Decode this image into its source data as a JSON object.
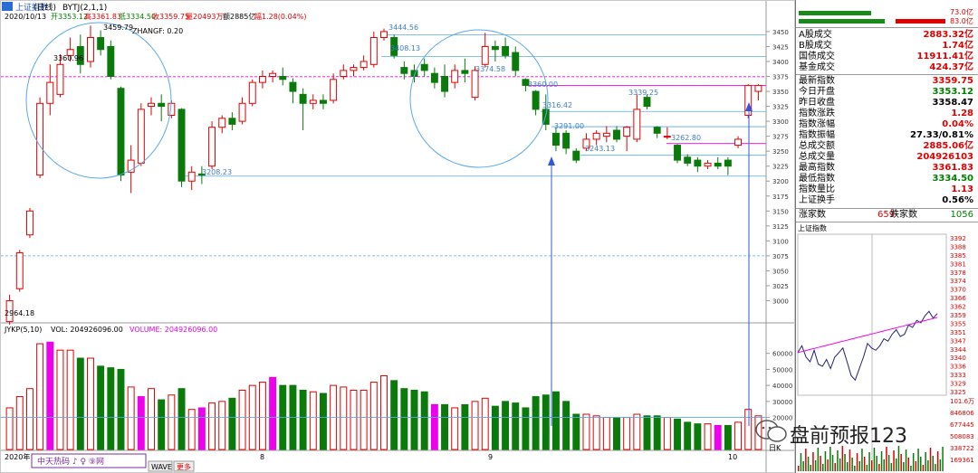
{
  "header": {
    "index_name": "上证指数",
    "period": "(日线)",
    "indicator": "BYTJ(2,1,1)",
    "date": "2020/10/13",
    "open": "开3353.12",
    "high": "高3361.83",
    "low": "低3334.50",
    "close": "收3359.75",
    "volume": "量20493万",
    "amount": "额2885亿",
    "change": "幅1.28(0.04%)",
    "zhangf": "ZHANGF: 0.20"
  },
  "annotations": {
    "a1": "3459.79",
    "a2": "3360.96",
    "a3": "3444.56",
    "a4": "3408.13",
    "a5": "3374.58",
    "a6": "3360.00",
    "a7": "3316.42",
    "a8": "3291.00",
    "a9": "3243.13",
    "a10": "3262.80",
    "a11": "3339.25",
    "a12": "3208.23",
    "a13": "2964.18"
  },
  "volume_header": {
    "name": "JYKP(5,10)",
    "vol": "VOL: 204926096.00",
    "volume": "VOLUME: 204926096.00"
  },
  "bottom_bar": {
    "year": "2020年",
    "m8": "8",
    "m9": "9",
    "m10": "10",
    "site": "中天热码 ♪ ♀ ⑨网",
    "tab_wave": "WAVE",
    "tab_more": "更多",
    "dayk": "日K"
  },
  "right_panel": {
    "top_vals": [
      "73.0亿",
      "83.0亿"
    ],
    "rows1": [
      {
        "label": "A股成交",
        "value": "2883.32亿",
        "color": "#e00000"
      },
      {
        "label": "B股成交",
        "value": "1.74亿",
        "color": "#e00000"
      },
      {
        "label": "国债成交",
        "value": "11911.41亿",
        "color": "#e00000"
      },
      {
        "label": "基金成交",
        "value": "424.37亿",
        "color": "#e00000"
      }
    ],
    "rows2": [
      {
        "label": "最新指数",
        "value": "3359.75",
        "color": "#e00000"
      },
      {
        "label": "今日开盘",
        "value": "3353.12",
        "color": "#008000"
      },
      {
        "label": "昨日收盘",
        "value": "3358.47",
        "color": "#000000"
      },
      {
        "label": "指数涨跌",
        "value": "1.28",
        "color": "#e00000"
      },
      {
        "label": "指数涨幅",
        "value": "0.04%",
        "color": "#e00000"
      },
      {
        "label": "指数振幅",
        "value": "27.33/0.81%",
        "color": "#000000"
      },
      {
        "label": "总成交额",
        "value": "2885.06亿",
        "color": "#e00000"
      },
      {
        "label": "总成交量",
        "value": "204926103",
        "color": "#e00000"
      },
      {
        "label": "最高指数",
        "value": "3361.83",
        "color": "#e00000"
      },
      {
        "label": "最低指数",
        "value": "3334.50",
        "color": "#008000"
      },
      {
        "label": "指数量比",
        "value": "1.13",
        "color": "#e00000"
      },
      {
        "label": "上证换手",
        "value": "0.56%",
        "color": "#000000"
      }
    ],
    "up_label": "涨家数",
    "up_count": "659",
    "down_label": "跌家数",
    "down_count": "1056",
    "mini_title": "上证指数",
    "mini_prices": [
      "3392",
      "3388",
      "3385",
      "3381",
      "3378",
      "3374",
      "3370",
      "3366",
      "3362",
      "3359",
      "3355",
      "3351",
      "3347",
      "3344",
      "3340",
      "3336",
      "3333",
      "3329",
      "3325"
    ],
    "mini_vol": [
      "101.6万",
      "846806",
      "677445",
      "508083",
      "338722",
      "169361"
    ]
  },
  "watermark": "盘前预报123",
  "chart_data": {
    "type": "candlestick",
    "price_axis": [
      "3450",
      "3425",
      "3400",
      "3375",
      "3350",
      "3325",
      "3300",
      "3275",
      "3250",
      "3225",
      "3200",
      "3175",
      "3150",
      "3125",
      "3100",
      "3075",
      "3050",
      "3025",
      "3000"
    ],
    "price_range": [
      2975,
      3465
    ],
    "volume_axis": [
      "60000",
      "50000",
      "40000",
      "30000",
      "20000"
    ],
    "volume_range": [
      0,
      70000
    ],
    "candles": [
      {
        "o": 2965,
        "c": 3000,
        "h": 3010,
        "l": 2960,
        "v": 26000,
        "up": true,
        "mag": false
      },
      {
        "o": 3020,
        "c": 3080,
        "h": 3085,
        "l": 3015,
        "v": 33000,
        "up": true,
        "mag": false
      },
      {
        "o": 3110,
        "c": 3150,
        "h": 3155,
        "l": 3105,
        "v": 38000,
        "up": true,
        "mag": false
      },
      {
        "o": 3210,
        "c": 3330,
        "h": 3340,
        "l": 3205,
        "v": 66000,
        "up": true,
        "mag": false
      },
      {
        "o": 3330,
        "c": 3365,
        "h": 3395,
        "l": 3310,
        "v": 67000,
        "up": true,
        "mag": true
      },
      {
        "o": 3345,
        "c": 3395,
        "h": 3412,
        "l": 3340,
        "v": 62000,
        "up": true,
        "mag": false
      },
      {
        "o": 3410,
        "c": 3420,
        "h": 3440,
        "l": 3400,
        "v": 62000,
        "up": true,
        "mag": false
      },
      {
        "o": 3425,
        "c": 3395,
        "h": 3445,
        "l": 3380,
        "v": 57000,
        "up": false,
        "mag": false
      },
      {
        "o": 3400,
        "c": 3440,
        "h": 3460,
        "l": 3390,
        "v": 57000,
        "up": true,
        "mag": false
      },
      {
        "o": 3440,
        "c": 3420,
        "h": 3452,
        "l": 3410,
        "v": 52000,
        "up": false,
        "mag": false
      },
      {
        "o": 3425,
        "c": 3375,
        "h": 3435,
        "l": 3370,
        "v": 51000,
        "up": false,
        "mag": false
      },
      {
        "o": 3355,
        "c": 3210,
        "h": 3358,
        "l": 3200,
        "v": 50000,
        "up": false,
        "mag": false
      },
      {
        "o": 3215,
        "c": 3235,
        "h": 3260,
        "l": 3180,
        "v": 39000,
        "up": true,
        "mag": false
      },
      {
        "o": 3230,
        "c": 3320,
        "h": 3330,
        "l": 3225,
        "v": 33000,
        "up": true,
        "mag": true
      },
      {
        "o": 3325,
        "c": 3330,
        "h": 3340,
        "l": 3310,
        "v": 38000,
        "up": true,
        "mag": false
      },
      {
        "o": 3330,
        "c": 3325,
        "h": 3345,
        "l": 3300,
        "v": 31000,
        "up": false,
        "mag": false
      },
      {
        "o": 3310,
        "c": 3330,
        "h": 3335,
        "l": 3305,
        "v": 34000,
        "up": true,
        "mag": false
      },
      {
        "o": 3320,
        "c": 3200,
        "h": 3322,
        "l": 3190,
        "v": 38000,
        "up": false,
        "mag": false
      },
      {
        "o": 3200,
        "c": 3215,
        "h": 3225,
        "l": 3185,
        "v": 25000,
        "up": true,
        "mag": false
      },
      {
        "o": 3212,
        "c": 3210,
        "h": 3225,
        "l": 3195,
        "v": 26000,
        "up": false,
        "mag": true
      },
      {
        "o": 3225,
        "c": 3290,
        "h": 3300,
        "l": 3220,
        "v": 29000,
        "up": true,
        "mag": false
      },
      {
        "o": 3290,
        "c": 3305,
        "h": 3310,
        "l": 3280,
        "v": 30000,
        "up": true,
        "mag": false
      },
      {
        "o": 3305,
        "c": 3295,
        "h": 3315,
        "l": 3285,
        "v": 32000,
        "up": false,
        "mag": false
      },
      {
        "o": 3300,
        "c": 3330,
        "h": 3340,
        "l": 3295,
        "v": 37000,
        "up": true,
        "mag": false
      },
      {
        "o": 3330,
        "c": 3365,
        "h": 3370,
        "l": 3325,
        "v": 40000,
        "up": true,
        "mag": false
      },
      {
        "o": 3365,
        "c": 3375,
        "h": 3385,
        "l": 3355,
        "v": 42000,
        "up": true,
        "mag": false
      },
      {
        "o": 3375,
        "c": 3380,
        "h": 3385,
        "l": 3365,
        "v": 45000,
        "up": true,
        "mag": true
      },
      {
        "o": 3375,
        "c": 3370,
        "h": 3390,
        "l": 3360,
        "v": 40000,
        "up": false,
        "mag": false
      },
      {
        "o": 3365,
        "c": 3350,
        "h": 3372,
        "l": 3330,
        "v": 40000,
        "up": false,
        "mag": false
      },
      {
        "o": 3345,
        "c": 3330,
        "h": 3355,
        "l": 3285,
        "v": 37000,
        "up": false,
        "mag": false
      },
      {
        "o": 3330,
        "c": 3335,
        "h": 3345,
        "l": 3320,
        "v": 36000,
        "up": true,
        "mag": false
      },
      {
        "o": 3335,
        "c": 3330,
        "h": 3345,
        "l": 3320,
        "v": 35000,
        "up": false,
        "mag": false
      },
      {
        "o": 3335,
        "c": 3370,
        "h": 3380,
        "l": 3330,
        "v": 40000,
        "up": true,
        "mag": false
      },
      {
        "o": 3375,
        "c": 3385,
        "h": 3395,
        "l": 3370,
        "v": 39000,
        "up": true,
        "mag": false
      },
      {
        "o": 3385,
        "c": 3390,
        "h": 3395,
        "l": 3375,
        "v": 37000,
        "up": true,
        "mag": false
      },
      {
        "o": 3390,
        "c": 3400,
        "h": 3410,
        "l": 3385,
        "v": 37000,
        "up": true,
        "mag": false
      },
      {
        "o": 3395,
        "c": 3440,
        "h": 3450,
        "l": 3390,
        "v": 42000,
        "up": true,
        "mag": false
      },
      {
        "o": 3440,
        "c": 3450,
        "h": 3455,
        "l": 3435,
        "v": 46000,
        "up": true,
        "mag": false
      },
      {
        "o": 3440,
        "c": 3410,
        "h": 3445,
        "l": 3405,
        "v": 43000,
        "up": false,
        "mag": false
      },
      {
        "o": 3390,
        "c": 3380,
        "h": 3400,
        "l": 3370,
        "v": 38000,
        "up": false,
        "mag": false
      },
      {
        "o": 3385,
        "c": 3375,
        "h": 3395,
        "l": 3365,
        "v": 37000,
        "up": false,
        "mag": false
      },
      {
        "o": 3395,
        "c": 3385,
        "h": 3405,
        "l": 3375,
        "v": 36000,
        "up": false,
        "mag": false
      },
      {
        "o": 3380,
        "c": 3365,
        "h": 3390,
        "l": 3355,
        "v": 28000,
        "up": false,
        "mag": true
      },
      {
        "o": 3375,
        "c": 3350,
        "h": 3395,
        "l": 3340,
        "v": 28000,
        "up": false,
        "mag": false
      },
      {
        "o": 3365,
        "c": 3385,
        "h": 3395,
        "l": 3355,
        "v": 26000,
        "up": true,
        "mag": false
      },
      {
        "o": 3385,
        "c": 3380,
        "h": 3405,
        "l": 3365,
        "v": 28000,
        "up": false,
        "mag": false
      },
      {
        "o": 3340,
        "c": 3385,
        "h": 3392,
        "l": 3335,
        "v": 30000,
        "up": true,
        "mag": false
      },
      {
        "o": 3395,
        "c": 3425,
        "h": 3448,
        "l": 3390,
        "v": 32000,
        "up": true,
        "mag": false
      },
      {
        "o": 3425,
        "c": 3420,
        "h": 3435,
        "l": 3400,
        "v": 27000,
        "up": false,
        "mag": false
      },
      {
        "o": 3425,
        "c": 3410,
        "h": 3440,
        "l": 3405,
        "v": 30000,
        "up": false,
        "mag": false
      },
      {
        "o": 3415,
        "c": 3385,
        "h": 3425,
        "l": 3375,
        "v": 29000,
        "up": false,
        "mag": false
      },
      {
        "o": 3370,
        "c": 3360,
        "h": 3372,
        "l": 3350,
        "v": 26000,
        "up": false,
        "mag": false
      },
      {
        "o": 3350,
        "c": 3320,
        "h": 3352,
        "l": 3310,
        "v": 33000,
        "up": false,
        "mag": false
      },
      {
        "o": 3320,
        "c": 3295,
        "h": 3345,
        "l": 3285,
        "v": 34000,
        "up": false,
        "mag": false
      },
      {
        "o": 3280,
        "c": 3260,
        "h": 3290,
        "l": 3250,
        "v": 36000,
        "up": false,
        "mag": false
      },
      {
        "o": 3280,
        "c": 3255,
        "h": 3285,
        "l": 3245,
        "v": 30000,
        "up": false,
        "mag": false
      },
      {
        "o": 3250,
        "c": 3235,
        "h": 3255,
        "l": 3230,
        "v": 22000,
        "up": false,
        "mag": false
      },
      {
        "o": 3255,
        "c": 3270,
        "h": 3280,
        "l": 3250,
        "v": 22000,
        "up": true,
        "mag": false
      },
      {
        "o": 3270,
        "c": 3280,
        "h": 3285,
        "l": 3260,
        "v": 21000,
        "up": true,
        "mag": false
      },
      {
        "o": 3275,
        "c": 3280,
        "h": 3292,
        "l": 3265,
        "v": 20000,
        "up": true,
        "mag": false
      },
      {
        "o": 3285,
        "c": 3270,
        "h": 3292,
        "l": 3265,
        "v": 20000,
        "up": false,
        "mag": false
      },
      {
        "o": 3275,
        "c": 3290,
        "h": 3292,
        "l": 3250,
        "v": 20000,
        "up": true,
        "mag": false
      },
      {
        "o": 3270,
        "c": 3320,
        "h": 3345,
        "l": 3265,
        "v": 22000,
        "up": true,
        "mag": false
      },
      {
        "o": 3340,
        "c": 3325,
        "h": 3345,
        "l": 3320,
        "v": 21000,
        "up": false,
        "mag": false
      },
      {
        "o": 3290,
        "c": 3280,
        "h": 3292,
        "l": 3272,
        "v": 21000,
        "up": false,
        "mag": false
      },
      {
        "o": 3275,
        "c": 3275,
        "h": 3290,
        "l": 3270,
        "v": 20000,
        "up": true,
        "mag": false
      },
      {
        "o": 3260,
        "c": 3235,
        "h": 3262,
        "l": 3230,
        "v": 19000,
        "up": false,
        "mag": false
      },
      {
        "o": 3240,
        "c": 3230,
        "h": 3245,
        "l": 3225,
        "v": 17000,
        "up": false,
        "mag": false
      },
      {
        "o": 3235,
        "c": 3225,
        "h": 3240,
        "l": 3215,
        "v": 16000,
        "up": false,
        "mag": false
      },
      {
        "o": 3225,
        "c": 3230,
        "h": 3235,
        "l": 3220,
        "v": 16000,
        "up": true,
        "mag": false
      },
      {
        "o": 3230,
        "c": 3225,
        "h": 3240,
        "l": 3220,
        "v": 15000,
        "up": false,
        "mag": true
      },
      {
        "o": 3235,
        "c": 3225,
        "h": 3240,
        "l": 3210,
        "v": 15000,
        "up": false,
        "mag": false
      },
      {
        "o": 3260,
        "c": 3270,
        "h": 3275,
        "l": 3255,
        "v": 17000,
        "up": true,
        "mag": false
      },
      {
        "o": 3310,
        "c": 3360,
        "h": 3362,
        "l": 3305,
        "v": 25000,
        "up": true,
        "mag": false
      },
      {
        "o": 3350,
        "c": 3360,
        "h": 3362,
        "l": 3335,
        "v": 21000,
        "up": true,
        "mag": false
      }
    ],
    "mini_intraday": [
      3342,
      3345,
      3340,
      3338,
      3343,
      3337,
      3336,
      3339,
      3335,
      3340,
      3342,
      3344,
      3338,
      3332,
      3330,
      3335,
      3340,
      3346,
      3344,
      3343,
      3345,
      3348,
      3347,
      3350,
      3352,
      3349,
      3350,
      3354,
      3353,
      3356,
      3355,
      3358,
      3360,
      3357,
      3359
    ]
  }
}
